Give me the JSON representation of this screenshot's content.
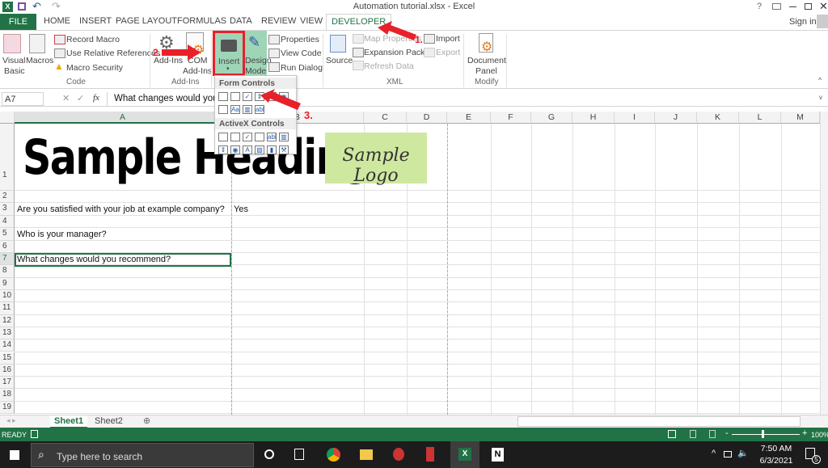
{
  "window": {
    "title": "Automation tutorial.xlsx - Excel",
    "help": "?",
    "sign_in": "Sign in"
  },
  "tabs": [
    "FILE",
    "HOME",
    "INSERT",
    "PAGE LAYOUT",
    "FORMULAS",
    "DATA",
    "REVIEW",
    "VIEW",
    "DEVELOPER"
  ],
  "active_tab": "DEVELOPER",
  "ribbon": {
    "code": {
      "label": "Code",
      "visual_basic": [
        "Visual",
        "Basic"
      ],
      "macros": "Macros",
      "record_macro": "Record Macro",
      "relative": "Use Relative References",
      "security": "Macro Security"
    },
    "addins": {
      "label": "Add-Ins",
      "addins": "Add-Ins",
      "com": [
        "COM",
        "Add-Ins"
      ]
    },
    "controls": {
      "insert": "Insert",
      "design": [
        "Design",
        "Mode"
      ],
      "properties": "Properties",
      "view_code": "View Code",
      "run_dialog": "Run Dialog"
    },
    "xml": {
      "label": "XML",
      "source": "Source",
      "map_properties": "Map Properties",
      "expansion": "Expansion Packs",
      "refresh": "Refresh Data",
      "import": "Import",
      "export": "Export"
    },
    "modify": {
      "label": "Modify",
      "document_panel": [
        "Document",
        "Panel"
      ]
    }
  },
  "insert_menu": {
    "form_controls": "Form Controls",
    "activex_controls": "ActiveX Controls",
    "form_icons": [
      "button",
      "combo-box",
      "checkbox",
      "spin-button",
      "list-box",
      "option-button",
      "group-box",
      "label",
      "scroll-bar",
      "text-field"
    ],
    "activex_icons": [
      "command-button",
      "combo-box",
      "checkbox",
      "list-box",
      "text-box",
      "scroll-bar",
      "spin-button",
      "option-button",
      "label",
      "image",
      "toggle-button",
      "more-controls"
    ],
    "activex_label_glyph": "A",
    "textfield_glyph": "abl",
    "label_glyph": "Aa"
  },
  "annotations": [
    "1.",
    "2.",
    "3."
  ],
  "formula_bar": {
    "name_box": "A7",
    "fx": "fx",
    "value": "What changes would you"
  },
  "columns": [
    "A",
    "B",
    "C",
    "D",
    "E",
    "F",
    "G",
    "H",
    "I",
    "J",
    "K",
    "L",
    "M"
  ],
  "rows": [
    "1",
    "2",
    "3",
    "4",
    "5",
    "6",
    "7",
    "8",
    "9",
    "10",
    "11",
    "12",
    "13",
    "14",
    "15",
    "16",
    "17",
    "18",
    "19"
  ],
  "cells": {
    "A1": "Sample Heading",
    "A3": "Are you satisfied with your job at example company?",
    "B3": "Yes",
    "A5": "Who is your manager?",
    "A7": "What changes would you recommend?"
  },
  "logo_text": "Sample Logo",
  "sheets": [
    "Sheet1",
    "Sheet2"
  ],
  "active_sheet": "Sheet1",
  "status": {
    "ready": "READY",
    "zoom": "100%",
    "zoom_minus": "-",
    "zoom_plus": "+"
  },
  "taskbar": {
    "search_placeholder": "Type here to search",
    "time": "7:50 AM",
    "date": "6/3/2021",
    "notifications": "5"
  },
  "colors": {
    "excel_green": "#217346",
    "annotation_red": "#e8202a",
    "logo_bg": "#cfe8a0"
  }
}
